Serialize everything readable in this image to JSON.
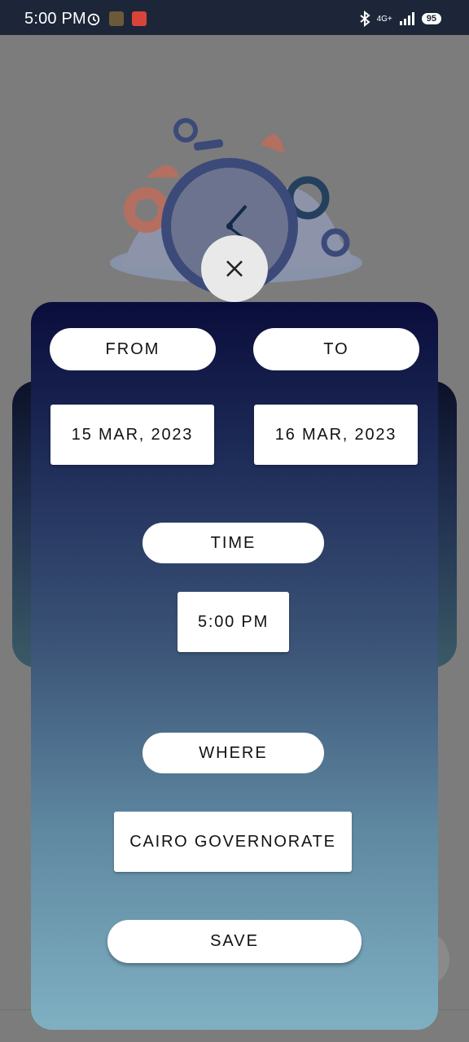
{
  "status_bar": {
    "time": "5:00 PM",
    "network": "4G+",
    "battery": "95"
  },
  "dialog": {
    "from_label": "FROM",
    "to_label": "TO",
    "from_date": "15 MAR, 2023",
    "to_date": "16 MAR, 2023",
    "time_label": "TIME",
    "time_value": "5:00 PM",
    "where_label": "WHERE",
    "where_value": "CAIRO GOVERNORATE",
    "save_label": "SAVE"
  },
  "icons": {
    "close": "close-icon",
    "alarm": "alarm-icon",
    "bluetooth": "bluetooth-icon",
    "signal": "signal-icon"
  },
  "colors": {
    "panel_top": "#0a0d3b",
    "panel_bottom": "#7fb0c2",
    "status_bar": "#1c2638"
  }
}
